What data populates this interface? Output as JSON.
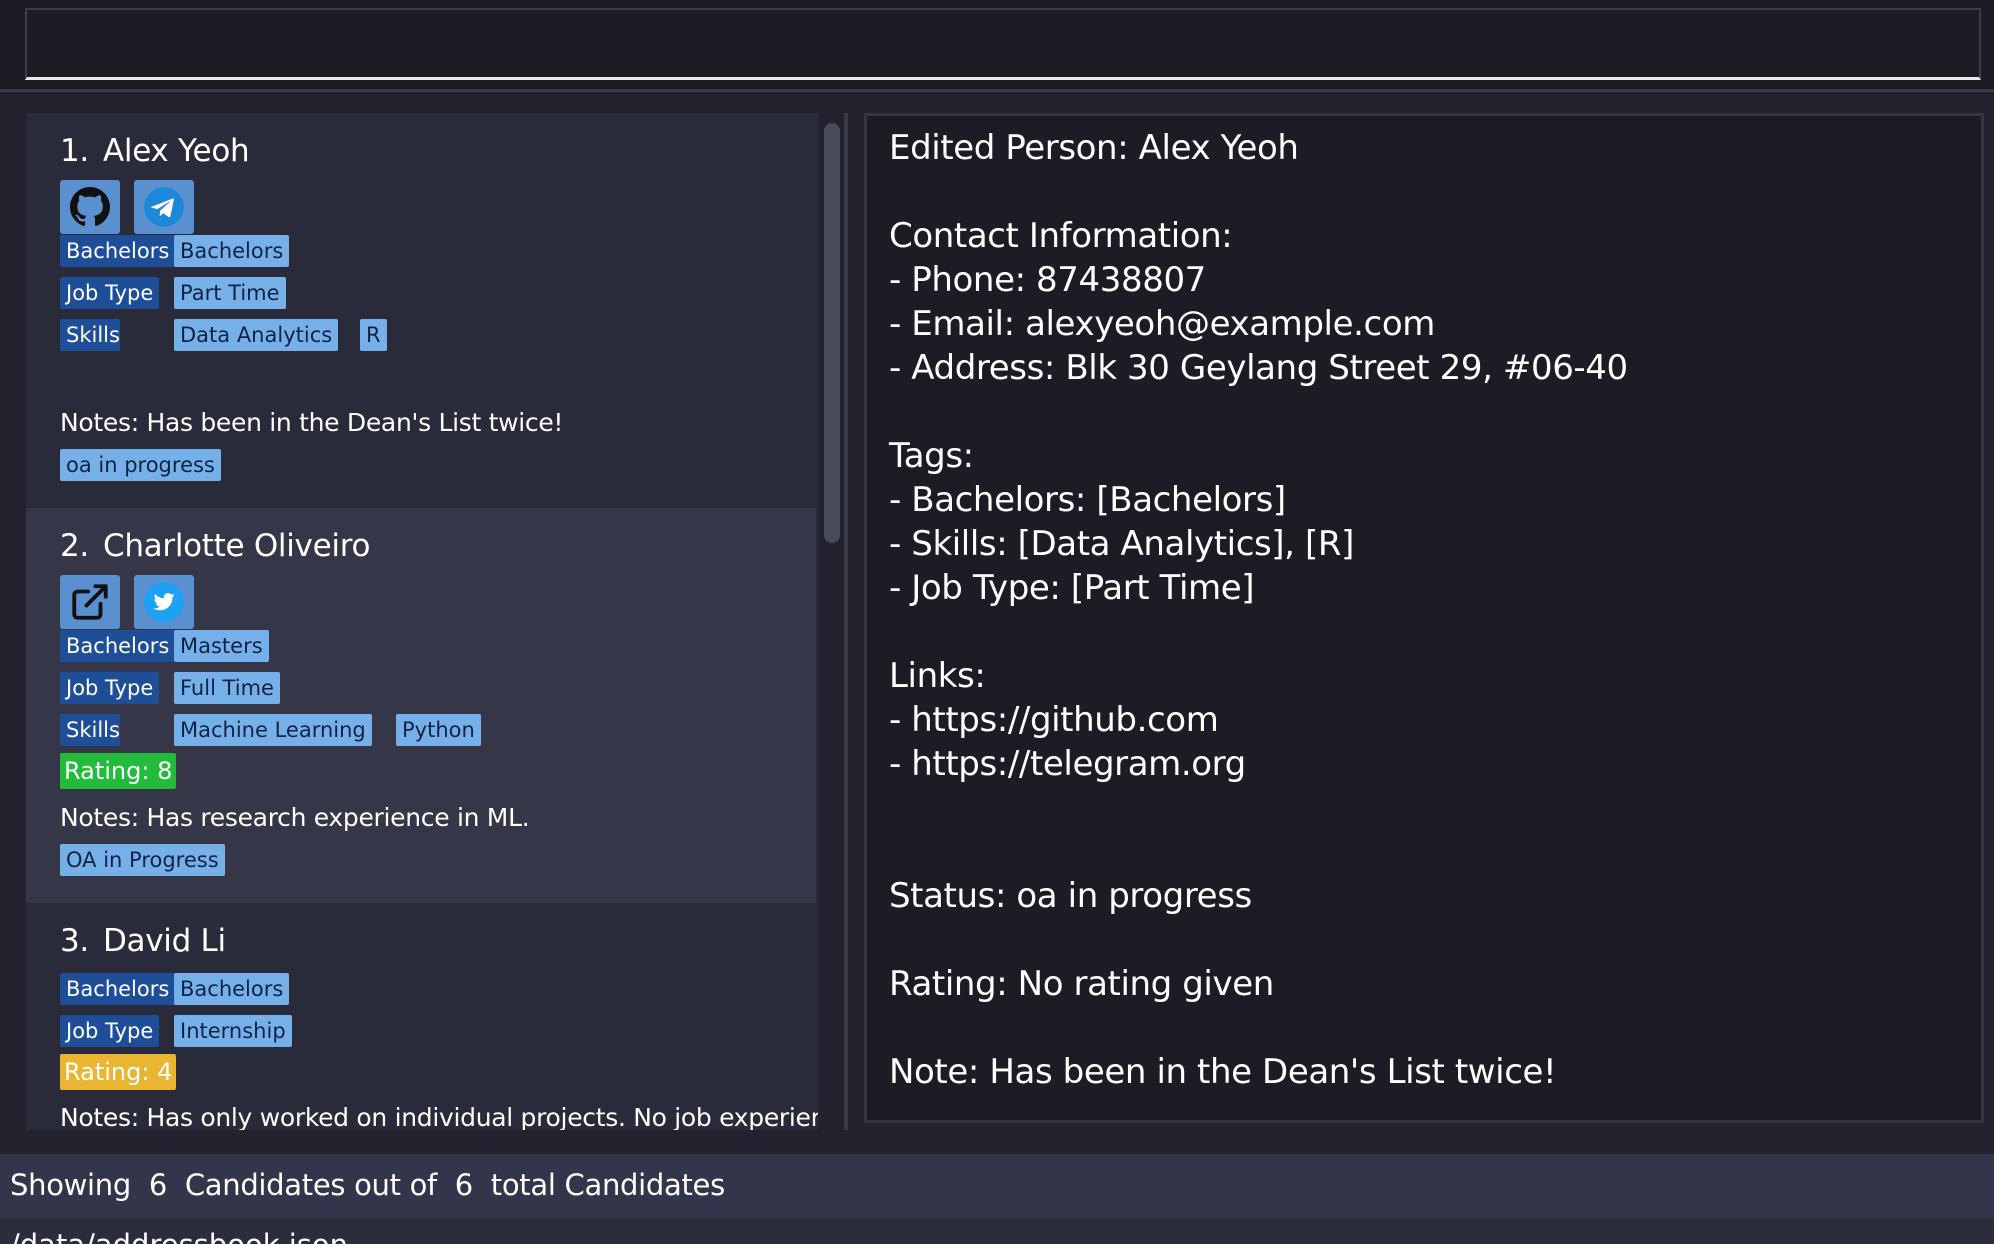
{
  "command_box": {
    "value": ""
  },
  "candidates": [
    {
      "index": "1.",
      "name": "Alex Yeoh",
      "icons": [
        "github-icon",
        "telegram-icon"
      ],
      "education": {
        "category": "Bachelors",
        "value": "Bachelors"
      },
      "job_type": {
        "category": "Job Type",
        "value": "Part Time"
      },
      "skills": {
        "category": "Skills",
        "values": [
          "Data Analytics",
          "R"
        ]
      },
      "rating": null,
      "notes": "Notes: Has been in the Dean's List twice!",
      "status": "oa in progress"
    },
    {
      "index": "2.",
      "name": "Charlotte Oliveiro",
      "icons": [
        "external-link-icon",
        "twitter-icon"
      ],
      "education": {
        "category": "Bachelors",
        "value": "Masters"
      },
      "job_type": {
        "category": "Job Type",
        "value": "Full Time"
      },
      "skills": {
        "category": "Skills",
        "values": [
          "Machine Learning",
          "Python"
        ]
      },
      "rating": "Rating: 8",
      "notes": "Notes: Has research experience in ML.",
      "status": "OA in Progress"
    },
    {
      "index": "3.",
      "name": "David Li",
      "icons": [],
      "education": {
        "category": "Bachelors",
        "value": "Bachelors"
      },
      "job_type": {
        "category": "Job Type",
        "value": "Internship"
      },
      "skills": null,
      "rating": "Rating: 4",
      "notes": "Notes: Has only worked on individual projects. No job experience.",
      "status": null
    }
  ],
  "detail": {
    "text": "Edited Person: Alex Yeoh\n\nContact Information:\n- Phone: 87438807\n- Email: alexyeoh@example.com\n- Address: Blk 30 Geylang Street 29, #06-40\n\nTags:\n- Bachelors: [Bachelors]\n- Skills: [Data Analytics], [R]\n- Job Type: [Part Time]\n\nLinks:\n- https://github.com\n- https://telegram.org\n\n\nStatus: oa in progress\n\nRating: No rating given\n\nNote: Has been in the Dean's List twice!"
  },
  "status_bar": {
    "text": "Showing  6  Candidates out of  6  total Candidates"
  },
  "file_path": "/data/addressbook.json",
  "colors": {
    "category_tag": "#1f4e99",
    "value_tag": "#75b1e8",
    "rating_high": "#22bb3c",
    "rating_mid": "#eab531",
    "icon_bg": "#5a8fd0"
  }
}
